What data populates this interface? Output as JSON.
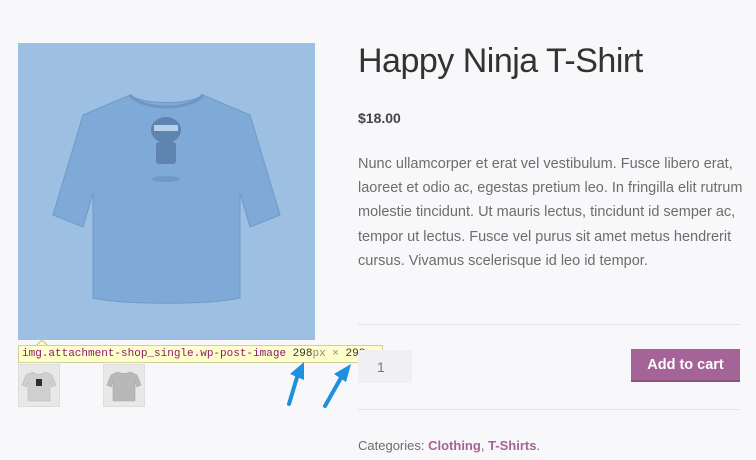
{
  "product": {
    "title": "Happy Ninja T-Shirt",
    "price": "$18.00",
    "description": "Nunc ullamcorper et erat vel vestibulum. Fusce libero erat, laoreet et odio ac, egestas pretium leo. In fringilla elit rutrum molestie tincidunt. Ut mauris lectus, tincidunt id semper ac, tempor ut lectus. Fusce vel purus sit amet metus hendrerit cursus. Vivamus scelerisque id leo id tempor.",
    "quantity": "1",
    "add_to_cart_label": "Add to cart",
    "categories_label": "Categories:",
    "categories": [
      "Clothing",
      "T-Shirts"
    ],
    "category_separator": ", ",
    "categories_end": "."
  },
  "inspector_tooltip": {
    "selector": "img.attachment-shop_single.wp-post-image",
    "width": "298",
    "width_unit": "px",
    "times": "×",
    "height": "298",
    "height_unit": "px"
  },
  "colors": {
    "accent": "#a46497",
    "image_highlight": "#9dbfe2",
    "annotation_arrow": "#1e90e0"
  }
}
